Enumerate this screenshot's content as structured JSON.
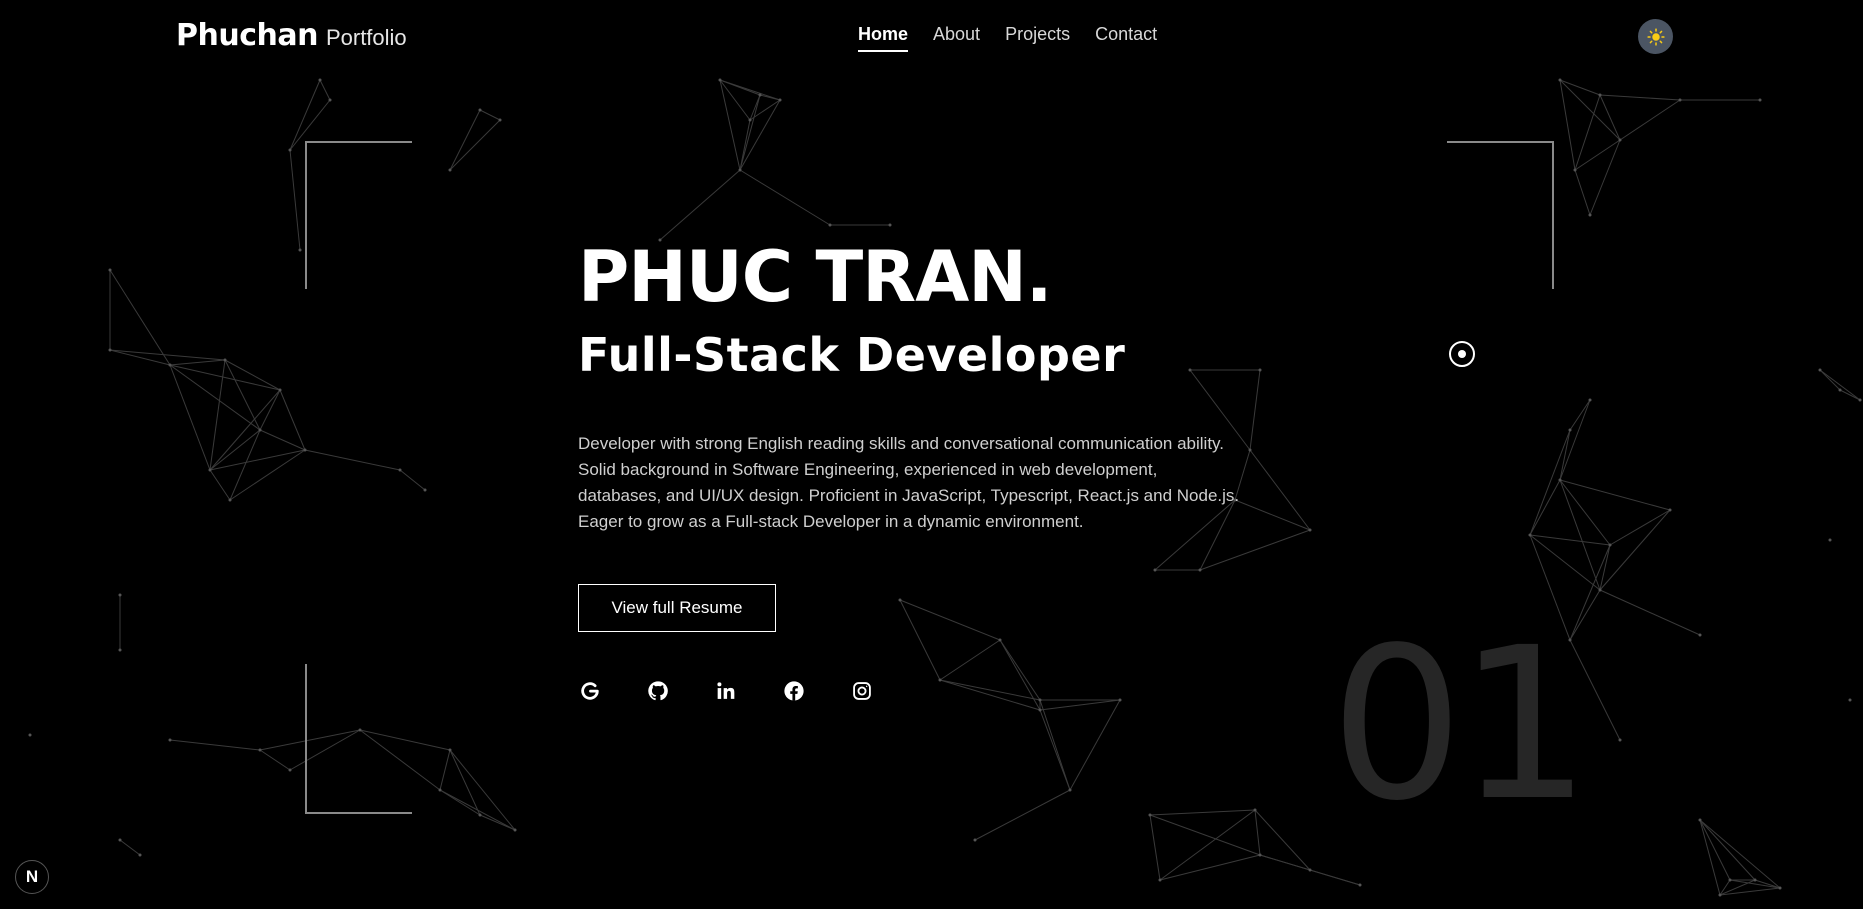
{
  "header": {
    "brand": "Phuchan",
    "brand_suffix": "Portfolio",
    "nav": [
      "Home",
      "About",
      "Projects",
      "Contact"
    ],
    "active_nav": "Home",
    "theme_icon": "sun-icon"
  },
  "hero": {
    "name": "PHUC TRAN.",
    "role": "Full-Stack Developer",
    "description": [
      "Developer with strong English reading skills and conversational communication ability.",
      "Solid background in Software Engineering, experienced in web development,",
      "databases, and UI/UX design. Proficient in JavaScript, Typescript, React.js and Node.js.",
      "Eager to grow as a Full-stack Developer in a dynamic environment."
    ],
    "resume_button": "View full Resume",
    "socials": [
      "google-icon",
      "github-icon",
      "linkedin-icon",
      "facebook-icon",
      "instagram-icon"
    ]
  },
  "section_number": "01",
  "badge": "N",
  "colors": {
    "background": "#000000",
    "text": "#ffffff",
    "theme_button": "#4b5563",
    "sun": "#facc15",
    "network_lines": "#3a3a3a",
    "section_number": "#262626"
  }
}
